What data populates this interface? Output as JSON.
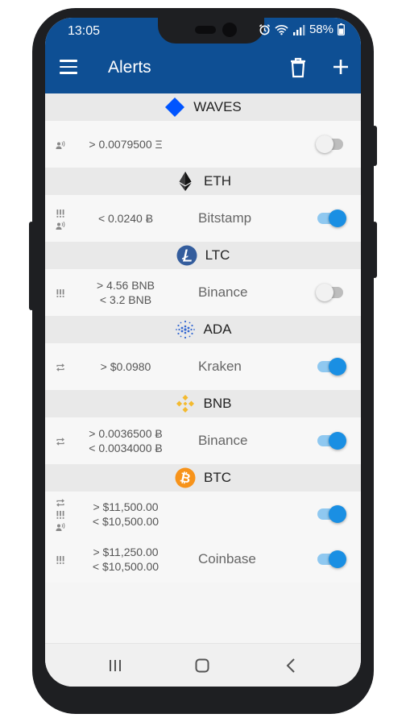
{
  "status": {
    "time": "13:05",
    "battery": "58%"
  },
  "appbar": {
    "title": "Alerts"
  },
  "colors": {
    "primary": "#0e4f94",
    "toggle_on": "#1a8fe3"
  },
  "groups": [
    {
      "coin": "WAVES",
      "icon": "waves-icon",
      "alerts": [
        {
          "flags": [
            "voice-flag-icon"
          ],
          "conditions": [
            "> 0.0079500 Ξ"
          ],
          "exchange": "",
          "enabled": false
        }
      ]
    },
    {
      "coin": "ETH",
      "icon": "eth-icon",
      "alerts": [
        {
          "flags": [
            "urgent-flag-icon",
            "voice-flag-icon"
          ],
          "conditions": [
            "< 0.0240 Ƀ"
          ],
          "exchange": "Bitstamp",
          "enabled": true
        }
      ]
    },
    {
      "coin": "LTC",
      "icon": "ltc-icon",
      "alerts": [
        {
          "flags": [
            "urgent-flag-icon"
          ],
          "conditions": [
            "> 4.56 BNB",
            "< 3.2 BNB"
          ],
          "exchange": "Binance",
          "enabled": false
        }
      ]
    },
    {
      "coin": "ADA",
      "icon": "ada-icon",
      "alerts": [
        {
          "flags": [
            "repeat-flag-icon"
          ],
          "conditions": [
            "> $0.0980"
          ],
          "exchange": "Kraken",
          "enabled": true
        }
      ]
    },
    {
      "coin": "BNB",
      "icon": "bnb-icon",
      "alerts": [
        {
          "flags": [
            "repeat-flag-icon"
          ],
          "conditions": [
            "> 0.0036500 Ƀ",
            "< 0.0034000 Ƀ"
          ],
          "exchange": "Binance",
          "enabled": true
        }
      ]
    },
    {
      "coin": "BTC",
      "icon": "btc-icon",
      "alerts": [
        {
          "flags": [
            "repeat-flag-icon",
            "urgent-flag-icon",
            "voice-flag-icon"
          ],
          "conditions": [
            "> $11,500.00",
            "< $10,500.00"
          ],
          "exchange": "",
          "enabled": true
        },
        {
          "flags": [
            "urgent-flag-icon"
          ],
          "conditions": [
            "> $11,250.00",
            "< $10,500.00"
          ],
          "exchange": "Coinbase",
          "enabled": true
        }
      ]
    }
  ]
}
